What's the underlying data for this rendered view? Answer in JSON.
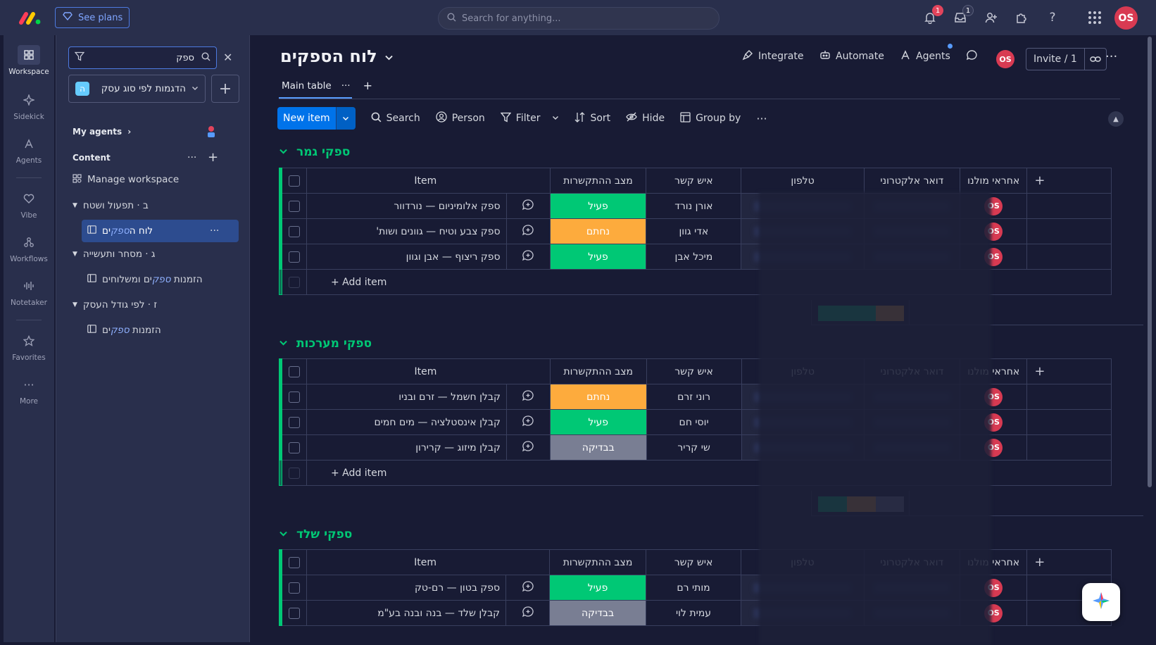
{
  "topbar": {
    "see_plans": "See plans",
    "search_placeholder": "Search for anything...",
    "notifications_count": "1",
    "inbox_count": "1",
    "avatar": "OS"
  },
  "rail": {
    "items": [
      {
        "label": "Workspace"
      },
      {
        "label": "Sidekick"
      },
      {
        "label": "Agents"
      },
      {
        "label": "Vibe"
      },
      {
        "label": "Workflows"
      },
      {
        "label": "Notetaker"
      },
      {
        "label": "Favorites"
      },
      {
        "label": "More"
      }
    ]
  },
  "workspace": {
    "search_value": "ספק",
    "selected_workspace": "הדגמות לפי סוג עסק",
    "workspace_letter": "ה",
    "my_agents": "My agents",
    "content": "Content",
    "manage": "Manage workspace",
    "tree": [
      {
        "folder": "ב · תפעול ושטח",
        "boards": [
          {
            "pre": "לוח ה",
            "hl": "ספק",
            "post": "ים"
          }
        ]
      },
      {
        "folder": "ג · מסחר ותעשייה",
        "boards": [
          {
            "pre": "הזמנות ",
            "hl": "ספק",
            "post": "ים ומשלוחים"
          }
        ]
      },
      {
        "folder": "ז · לפי גודל העסק",
        "boards": [
          {
            "pre": "הזמנות ",
            "hl": "ספק",
            "post": "ים"
          }
        ]
      }
    ]
  },
  "board": {
    "title": "לוח הספקים",
    "integrate": "Integrate",
    "automate": "Automate",
    "agents": "Agents",
    "avatar": "OS",
    "invite": "Invite / 1",
    "tab": "Main table",
    "toolbar": {
      "new_item": "New item",
      "search": "Search",
      "person": "Person",
      "filter": "Filter",
      "sort": "Sort",
      "hide": "Hide",
      "group_by": "Group by"
    }
  },
  "columns": {
    "item": "Item",
    "status": "מצב ההתקשרות",
    "contact": "איש קשר",
    "phone": "טלפון",
    "email": "דואר אלקטרוני",
    "owner": "אחראי מולנו"
  },
  "add_item": "+ Add item",
  "colors": {
    "active": "#00c875",
    "signed": "#fdab3d",
    "review": "#797e93",
    "group": "#00c875"
  },
  "groups": [
    {
      "title": "ספקי גמר",
      "rows": [
        {
          "item": "ספק אלומיניום — נורדוור",
          "status": "פעיל",
          "status_color": "green",
          "contact": "אורן נורד",
          "owner": "OS"
        },
        {
          "item": "ספק צבע וטיח — גוונים ושות'",
          "status": "נחתם",
          "status_color": "orange",
          "contact": "אדי גוון",
          "owner": "OS"
        },
        {
          "item": "ספק ריצוף — אבן וגוון",
          "status": "פעיל",
          "status_color": "green",
          "contact": "מיכל אבן",
          "owner": "OS"
        }
      ],
      "summary": [
        {
          "color": "#00c875",
          "share": 0.67
        },
        {
          "color": "#fdab3d",
          "share": 0.33
        }
      ]
    },
    {
      "title": "ספקי מערכות",
      "rows": [
        {
          "item": "קבלן חשמל — זרם ובניו",
          "status": "נחתם",
          "status_color": "orange",
          "contact": "רוני זרם",
          "owner": "OS"
        },
        {
          "item": "קבלן אינסטלציה — מים חמים",
          "status": "פעיל",
          "status_color": "green",
          "contact": "יוסי חם",
          "owner": "OS"
        },
        {
          "item": "קבלן מיזוג — קרירון",
          "status": "בבדיקה",
          "status_color": "gray",
          "contact": "שי קריר",
          "owner": "OS"
        }
      ],
      "summary": [
        {
          "color": "#00c875",
          "share": 0.34
        },
        {
          "color": "#fdab3d",
          "share": 0.33
        },
        {
          "color": "#797e93",
          "share": 0.33
        }
      ]
    },
    {
      "title": "ספקי שלד",
      "rows": [
        {
          "item": "ספק בטון — רם-טק",
          "status": "פעיל",
          "status_color": "green",
          "contact": "מותי רם",
          "owner": "OS"
        },
        {
          "item": "קבלן שלד — בנה ובנה בע\"מ",
          "status": "בבדיקה",
          "status_color": "gray",
          "contact": "עמית לוי",
          "owner": "OS"
        }
      ]
    }
  ]
}
